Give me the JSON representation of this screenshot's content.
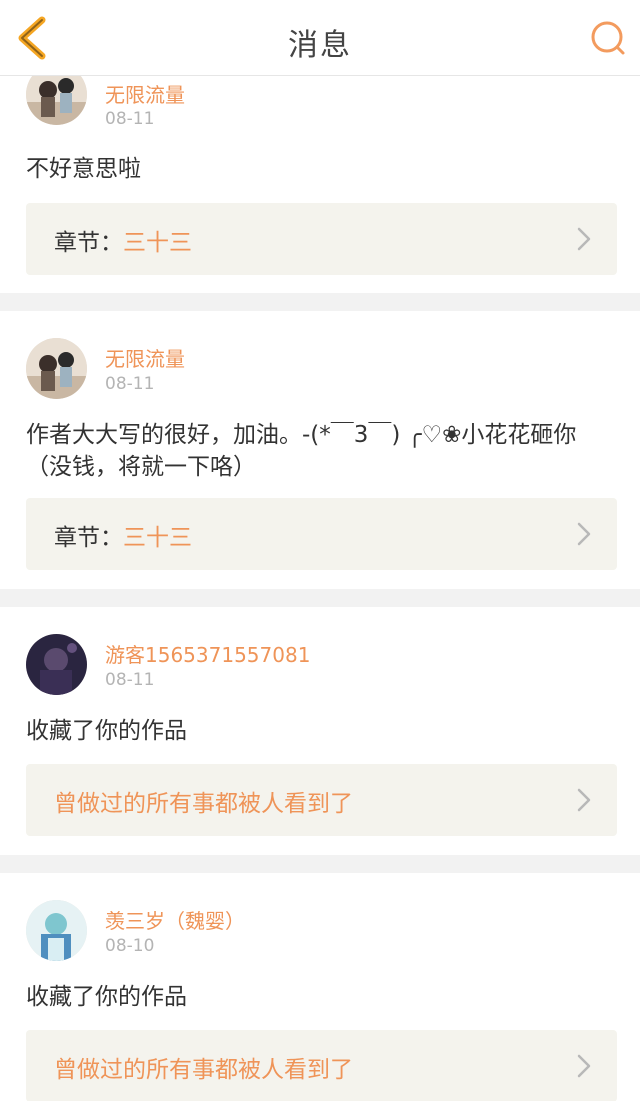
{
  "header": {
    "title": "消息",
    "back_icon": "chevron-left-icon",
    "search_icon": "search-icon",
    "accent_color": "#f5a623",
    "search_color": "#f39b5e"
  },
  "messages": [
    {
      "username": "无限流量",
      "date": "08-11",
      "text": "不好意思啦",
      "chapter_label": "章节：",
      "chapter_value": "三十三"
    },
    {
      "username": "无限流量",
      "date": "08-11",
      "text": "作者大大写的很好，加油。-(*￣3￣) ╭♡❀小花花砸你（没钱，将就一下咯）",
      "chapter_label": "章节：",
      "chapter_value": "三十三"
    },
    {
      "username": "游客1565371557081",
      "date": "08-11",
      "text": "收藏了你的作品",
      "work_title": "曾做过的所有事都被人看到了"
    },
    {
      "username": "羡三岁（魏婴）",
      "date": "08-10",
      "text": "收藏了你的作品",
      "work_title": "曾做过的所有事都被人看到了"
    }
  ],
  "colors": {
    "orange_text": "#ef9458",
    "card_box": "#f4f3ed",
    "separator": "#f2f2f2"
  }
}
